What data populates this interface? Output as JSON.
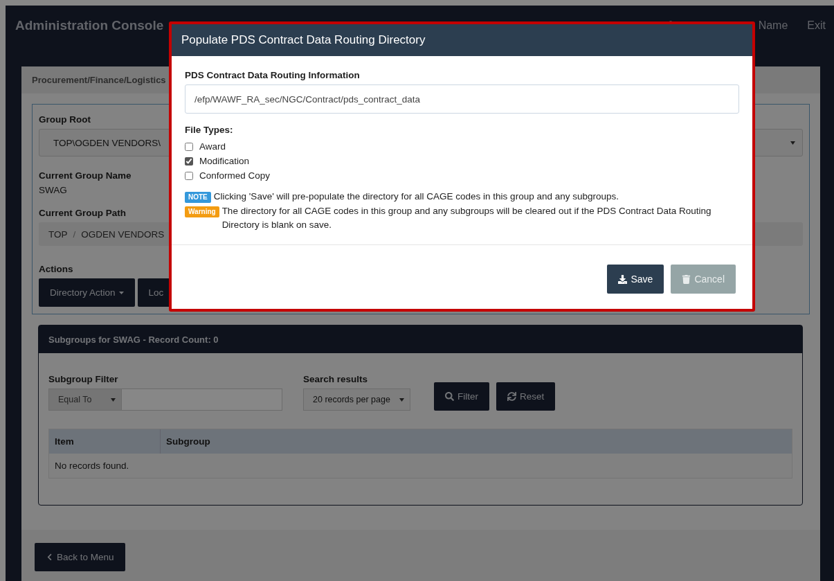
{
  "header": {
    "title": "Administration Console",
    "user": "Name",
    "exit": "Exit"
  },
  "card": {
    "title": "Procurement/Finance/Logistics",
    "group_root": {
      "label": "Group Root",
      "value": "TOP\\OGDEN VENDORS\\"
    },
    "group_name": {
      "label": "Current Group Name",
      "value": "SWAG"
    },
    "group_path": {
      "label": "Current Group Path",
      "crumbs": [
        "TOP",
        "OGDEN VENDORS"
      ],
      "separator": "/"
    },
    "actions": {
      "label": "Actions",
      "buttons": [
        {
          "label": "Directory Action",
          "kind": "dropdown"
        },
        {
          "label": "Loc",
          "kind": "plain"
        }
      ]
    }
  },
  "subgroups": {
    "title": "Subgroups for SWAG - Record Count: 0",
    "filter": {
      "label": "Subgroup Filter",
      "operator": "Equal To"
    },
    "search": {
      "label": "Search results",
      "value": "20 records per page"
    },
    "buttons": [
      {
        "label": "Filter",
        "kind": "filter"
      },
      {
        "label": "Reset",
        "kind": "reset"
      }
    ],
    "columns": [
      "Item",
      "Subgroup"
    ],
    "empty": "No records found."
  },
  "back_button": "Back to Menu",
  "modal": {
    "title": "Populate PDS Contract Data Routing Directory",
    "field": {
      "label": "PDS Contract Data Routing Information",
      "value": "/efp/WAWF_RA_sec/NGC/Contract/pds_contract_data"
    },
    "file_types": {
      "label": "File Types:",
      "options": [
        {
          "label": "Award",
          "checked": false
        },
        {
          "label": "Modification",
          "checked": true
        },
        {
          "label": "Conformed Copy",
          "checked": false
        }
      ]
    },
    "notes": [
      {
        "kind": "note",
        "badge": "NOTE",
        "text": "Clicking 'Save' will pre-populate the directory for all CAGE codes in this group and any subgroups."
      },
      {
        "kind": "warning",
        "badge": "Warning",
        "text": "The directory for all CAGE codes in this group and any subgroups will be cleared out if the PDS Contract Data Routing Directory is blank on save."
      }
    ],
    "buttons": [
      {
        "label": "Save",
        "kind": "save",
        "disabled": false
      },
      {
        "label": "Cancel",
        "kind": "cancel",
        "disabled": true
      }
    ]
  }
}
